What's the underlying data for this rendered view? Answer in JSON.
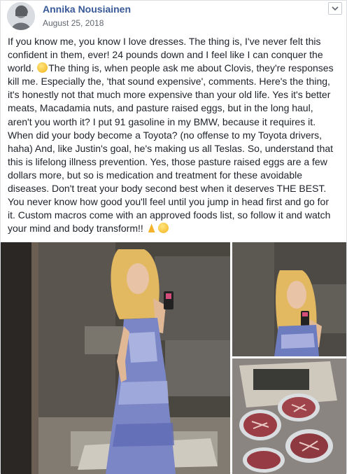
{
  "post": {
    "author_name": "Annika Nousiainen",
    "date": "August 25, 2018",
    "text_line_1": "If you know me, you know I love dresses. The thing is, I've never felt this confident in them, ever! 24 pounds down and I feel like I can conquer the world. ",
    "text_line_2": "The thing is, when people ask me about Clovis, they're responses kill me. Especially the, 'that sound expensive', comments. Here's the thing, it's honestly not that much more expensive than your old life. Yes it's better meats, Macadamia nuts, and pasture raised eggs, but in the long haul, aren't you worth it? I put 91 gasoline in my BMW, because it requires it. When did your body become a Toyota? (no offense to my Toyota drivers, haha) And, like Justin's goal, he's making us all Teslas. So, understand that this is lifelong illness prevention. Yes, those pasture raised eggs are a few dollars more, but so is medication and treatment for these avoidable diseases. Don't treat your body second best when it deserves THE BEST. You never know how good you'll feel until you jump in head first and go for it. Custom macros come with an approved foods list, so follow it and watch your mind and body transform!! "
  },
  "icons": {
    "avatar": "profile-avatar",
    "menu": "chevron-down-icon",
    "emoji_1": "smiling-face-icon",
    "emoji_2": "folded-hands-icon",
    "emoji_3": "smiling-face-icon"
  },
  "colors": {
    "author_link": "#385898",
    "text": "#1d2129",
    "meta": "#616770",
    "border": "#dddfe2"
  }
}
